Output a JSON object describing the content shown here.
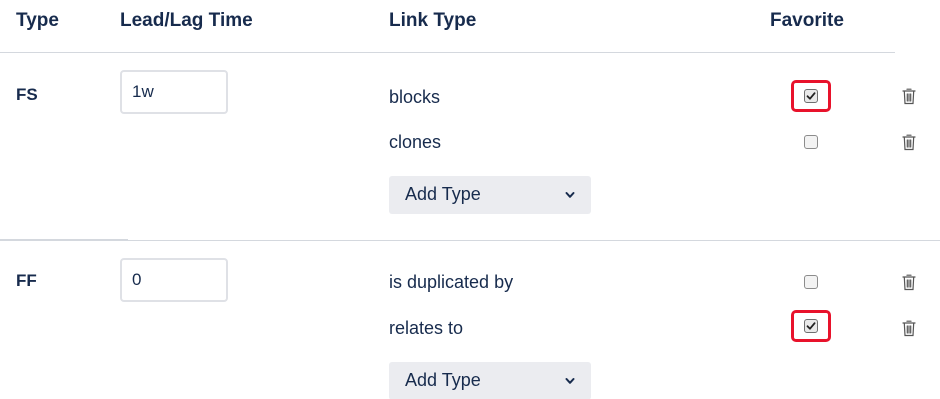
{
  "headers": {
    "type": "Type",
    "lag": "Lead/Lag Time",
    "link": "Link Type",
    "favorite": "Favorite"
  },
  "groups": [
    {
      "type": "FS",
      "lag_value": "1w",
      "links": [
        {
          "label": "blocks",
          "favorite": true,
          "highlighted": true
        },
        {
          "label": "clones",
          "favorite": false,
          "highlighted": false
        }
      ],
      "add_type_label": "Add Type"
    },
    {
      "type": "FF",
      "lag_value": "0",
      "links": [
        {
          "label": "is duplicated by",
          "favorite": false,
          "highlighted": false
        },
        {
          "label": "relates to",
          "favorite": true,
          "highlighted": true
        }
      ],
      "add_type_label": "Add Type"
    }
  ],
  "icons": {
    "delete": "trash-icon",
    "select": "chevron-down-icon",
    "check": "checkmark-icon"
  },
  "colors": {
    "text": "#172b4d",
    "highlight": "#e8122b",
    "select_bg": "#ebecf0",
    "divider": "#d4d8de"
  }
}
